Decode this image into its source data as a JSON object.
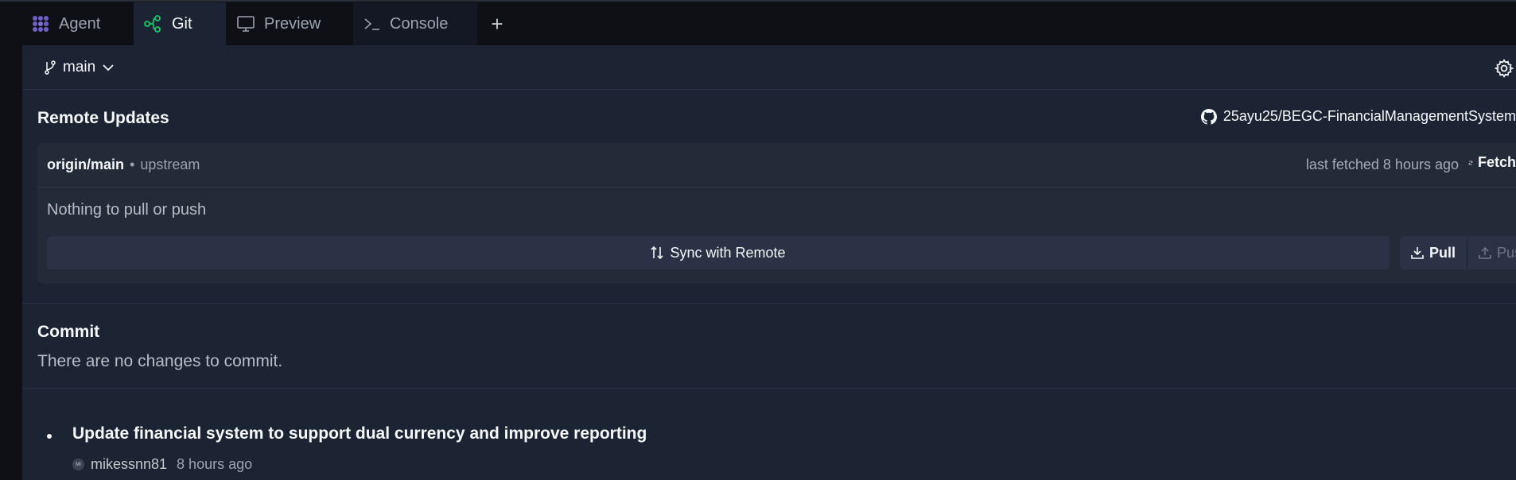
{
  "tabs": [
    {
      "label": "Agent",
      "icon": "agent-icon"
    },
    {
      "label": "Git",
      "icon": "git-branch-icon"
    },
    {
      "label": "Preview",
      "icon": "monitor-icon"
    },
    {
      "label": "Console",
      "icon": "terminal-icon"
    }
  ],
  "new_tab_label": "+",
  "branch": {
    "name": "main"
  },
  "remote": {
    "section_title": "Remote Updates",
    "repo": "25ayu25/BEGC-FinancialManagementSystem",
    "remote_name": "origin/main",
    "separator": "•",
    "upstream_label": "upstream",
    "last_fetched": "last fetched 8 hours ago",
    "fetch_label": "Fetch",
    "status": "Nothing to pull or push",
    "sync_label": "Sync with Remote",
    "pull_label": "Pull",
    "push_label": "Push"
  },
  "commit": {
    "section_title": "Commit",
    "message": "There are no changes to commit."
  },
  "history": [
    {
      "title": "Update financial system to support dual currency and improve reporting",
      "avatar_initials": "MI",
      "author": "mikessnn81",
      "time": "8 hours ago"
    }
  ],
  "colors": {
    "accent_green": "#0cce6b",
    "agent_purple": "#6e5fc9",
    "panel_bg": "#1c2333",
    "tabbar_bg": "#0e1016"
  }
}
